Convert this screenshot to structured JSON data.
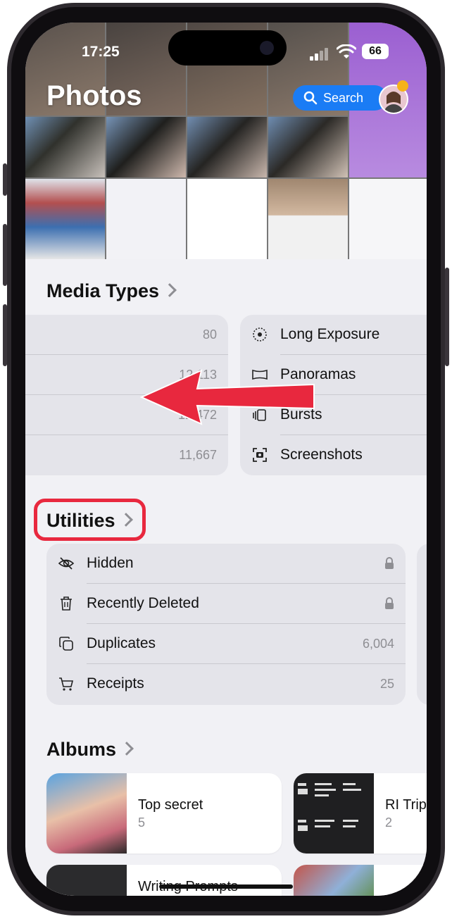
{
  "status_bar": {
    "time": "17:25",
    "battery": "66"
  },
  "header": {
    "title": "Photos",
    "search_label": "Search"
  },
  "media_types": {
    "title": "Media Types",
    "left_counts": [
      "80",
      "12,113",
      "12,472",
      "11,667"
    ],
    "items": [
      {
        "label": "Long Exposure",
        "icon": "long-exposure-icon"
      },
      {
        "label": "Panoramas",
        "icon": "panorama-icon"
      },
      {
        "label": "Bursts",
        "icon": "bursts-icon"
      },
      {
        "label": "Screenshots",
        "icon": "screenshot-icon"
      }
    ]
  },
  "utilities": {
    "title": "Utilities",
    "items": [
      {
        "label": "Hidden",
        "icon": "eye-slash-icon",
        "trailing_icon": "lock-icon"
      },
      {
        "label": "Recently Deleted",
        "icon": "trash-icon",
        "trailing_icon": "lock-icon"
      },
      {
        "label": "Duplicates",
        "icon": "duplicate-icon",
        "count": "6,004"
      },
      {
        "label": "Receipts",
        "icon": "cart-icon",
        "count": "25"
      }
    ]
  },
  "albums": {
    "title": "Albums",
    "items": [
      {
        "name": "Top secret",
        "count": "5"
      },
      {
        "name": "RI Trip",
        "count": "2"
      },
      {
        "name": "Writing Prompts"
      }
    ]
  },
  "colors": {
    "accent": "#1a7cf5",
    "highlight": "#e8283e",
    "arrow": "#e8283e"
  }
}
